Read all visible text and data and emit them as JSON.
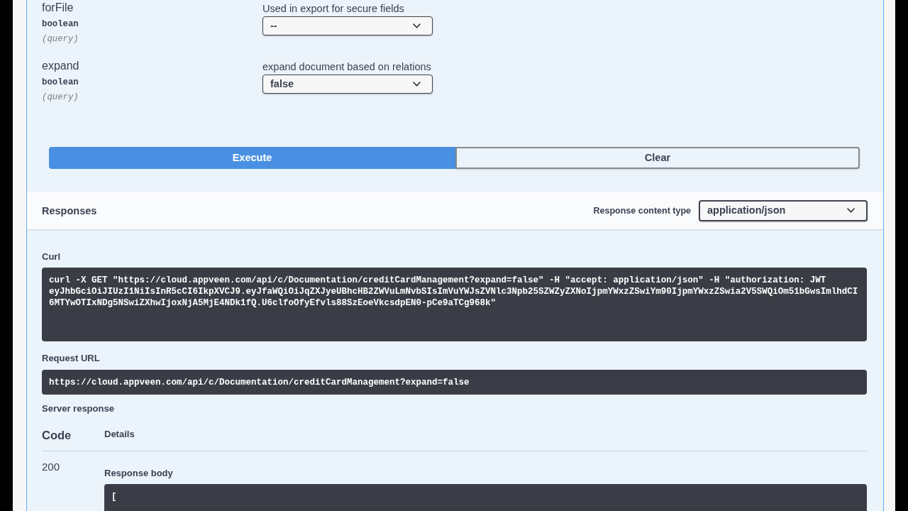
{
  "parameters": [
    {
      "name": "forFile",
      "type": "boolean",
      "location": "(query)",
      "description": "Used in export for secure fields",
      "value": "--"
    },
    {
      "name": "expand",
      "type": "boolean",
      "location": "(query)",
      "description": "expand document based on relations",
      "value": "false"
    }
  ],
  "buttons": [
    {
      "label": "Execute",
      "kind": "primary"
    },
    {
      "label": "Clear",
      "kind": "secondary"
    }
  ],
  "responses": {
    "title": "Responses",
    "content_type_label": "Response content type",
    "content_type": "application/json"
  },
  "curl": {
    "label": "Curl",
    "command": "curl -X GET \"https://cloud.appveen.com/api/c/Documentation/creditCardManagement?expand=false\" -H \"accept: application/json\" -H \"authorization: JWT eyJhbGciOiJIUzI1NiIsInR5cCI6IkpXVCJ9.eyJfaWQiOiJqZXJyeUBhcHB2ZWVuLmNvbSIsImVuYWJsZVNlc3Npb25SZWZyZXNoIjpmYWxzZSwiYm90IjpmYWxzZSwia2V5SWQiOm51bGwsImlhdCI6MTYwOTIxNDg5NSwiZXhwIjoxNjA5MjE4NDk1fQ.U6clfoOfyEfvls88SzEoeVkcsdpEN0-pCe9aTCg968k\""
  },
  "request_url": {
    "label": "Request URL",
    "url": "https://cloud.appveen.com/api/c/Documentation/creditCardManagement?expand=false"
  },
  "server_response": {
    "label": "Server response",
    "columns": [
      "Code",
      "Details"
    ],
    "rows": [
      {
        "code": "200",
        "body_label": "Response body",
        "body": "["
      }
    ]
  }
}
